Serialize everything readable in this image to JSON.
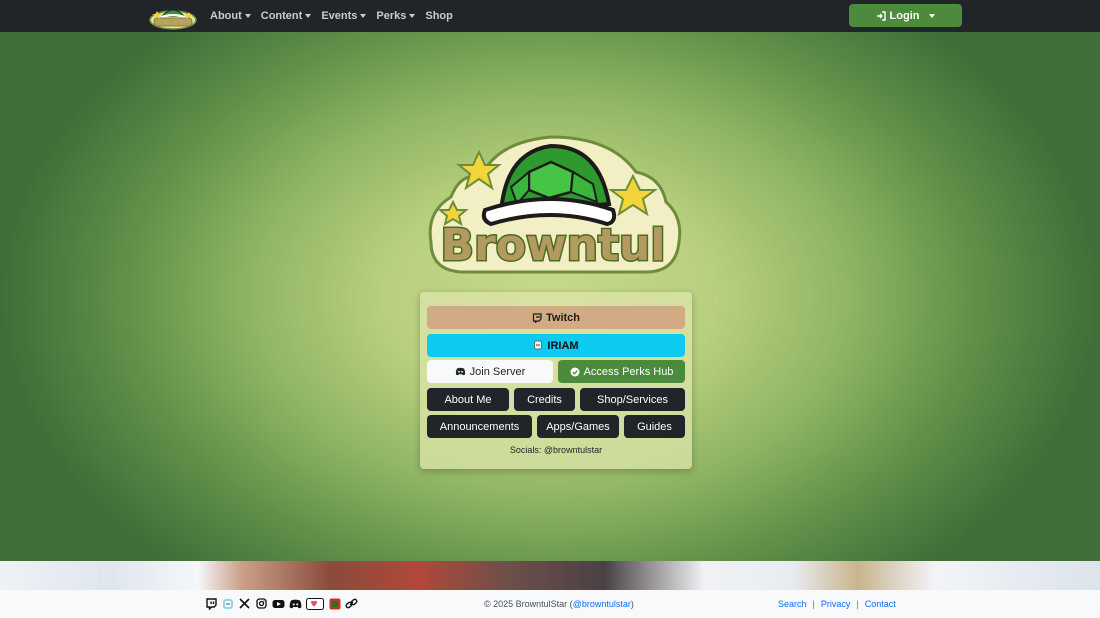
{
  "navbar": {
    "brand_logo": "browntul-shell-logo",
    "links": [
      {
        "label": "About",
        "has_dropdown": true
      },
      {
        "label": "Content",
        "has_dropdown": true
      },
      {
        "label": "Events",
        "has_dropdown": true
      },
      {
        "label": "Perks",
        "has_dropdown": true
      },
      {
        "label": "Shop",
        "has_dropdown": false
      }
    ],
    "login": {
      "label": "Login",
      "icon": "login-icon"
    }
  },
  "hero": {
    "logo_text": "Browntul",
    "buttons": {
      "twitch": {
        "label": "Twitch",
        "icon": "twitch-icon"
      },
      "iriam": {
        "label": "IRIAM",
        "icon": "iriam-icon"
      },
      "join_server": {
        "label": "Join Server",
        "icon": "discord-icon"
      },
      "perks_hub": {
        "label": "Access Perks Hub",
        "icon": "check-circle-icon"
      },
      "about_me": {
        "label": "About Me"
      },
      "credits": {
        "label": "Credits"
      },
      "shop_services": {
        "label": "Shop/Services"
      },
      "announcements": {
        "label": "Announcements"
      },
      "apps_games": {
        "label": "Apps/Games"
      },
      "guides": {
        "label": "Guides"
      }
    },
    "socials": "Socials: @browntulstar"
  },
  "footer": {
    "social_icons": [
      "twitch-icon",
      "iriam-icon",
      "x-icon",
      "instagram-icon",
      "youtube-icon",
      "discord-icon",
      "throne-icon",
      "carrd-icon",
      "link-icon"
    ],
    "copyright": "© 2025 BrowntulStar (",
    "handle": "@browntulstar",
    "copyright_end": ")",
    "links": [
      {
        "label": "Search"
      },
      {
        "label": "Privacy"
      },
      {
        "label": "Contact"
      }
    ]
  },
  "colors": {
    "navbar_bg": "#212529",
    "brand_green": "#4b8b3b",
    "twitch_tan": "#d2ab84",
    "iriam_cyan": "#0dcaf0",
    "dark_button": "#212529",
    "link_blue": "#0d6efd"
  }
}
